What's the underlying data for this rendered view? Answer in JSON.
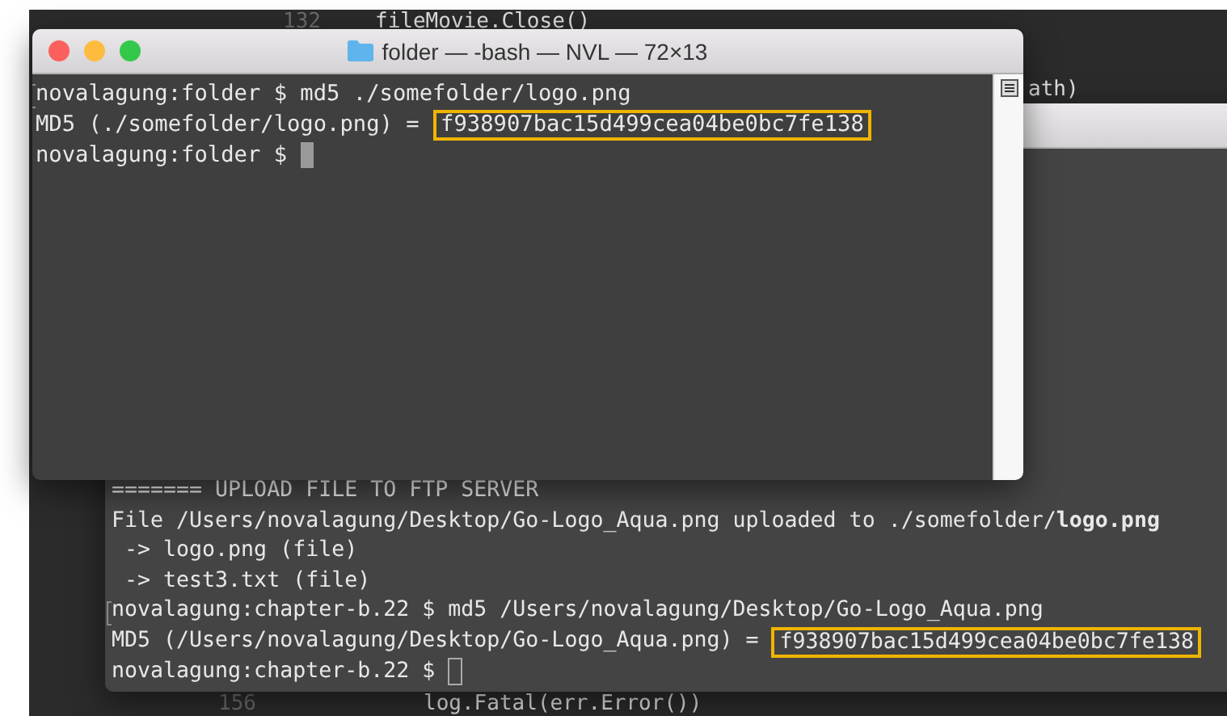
{
  "editor": {
    "top_line": {
      "number": "132",
      "code": "fileMovie.Close()"
    },
    "side_fragment": "ath)",
    "bottom_line": {
      "number": "156",
      "code": "log.Fatal(err.Error())"
    }
  },
  "back_terminal": {
    "active": false,
    "lines": [
      {
        "text": "======= UPLOAD FILE TO FTP SERVER",
        "marked": false
      },
      {
        "text": "File /Users/novalagung/Desktop/Go-Logo_Aqua.png uploaded to ./somefolder/**logo.png**",
        "marked": false
      },
      {
        "text": " -> logo.png (file)",
        "marked": false
      },
      {
        "text": " -> test3.txt (file)",
        "marked": false
      },
      {
        "text": "novalagung:chapter-b.22 $ md5 /Users/novalagung/Desktop/Go-Logo_Aqua.png",
        "marked": true
      },
      {
        "text": "MD5 (/Users/novalagung/Desktop/Go-Logo_Aqua.png) = ",
        "highlight": "f938907bac15d499cea04be0bc7fe138",
        "marked": false
      }
    ],
    "prompt": "novalagung:chapter-b.22 $"
  },
  "front_terminal": {
    "title": "folder — -bash — NVL — 72×13",
    "active": true,
    "lines": [
      {
        "text": "novalagung:folder $ md5 ./somefolder/logo.png",
        "marked": true
      },
      {
        "text": "MD5 (./somefolder/logo.png) = ",
        "highlight": "f938907bac15d499cea04be0bc7fe138",
        "marked": false
      }
    ],
    "prompt": "novalagung:folder $"
  }
}
